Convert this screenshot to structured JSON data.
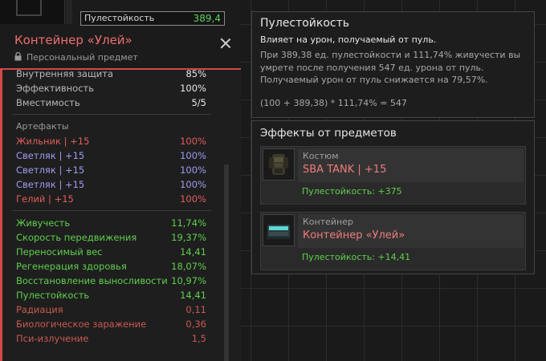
{
  "top_stat": {
    "label": "Пулестойкость",
    "value": "389,4"
  },
  "item": {
    "title": "Контейнер «Улей»",
    "subtitle": "Персональный предмет",
    "stats": [
      {
        "label": "Внутренняя защита",
        "value": "85%"
      },
      {
        "label": "Эффективность",
        "value": "100%"
      },
      {
        "label": "Вместимость",
        "value": "5/5"
      }
    ],
    "artifacts_header": "Артефакты",
    "artifacts": [
      {
        "label": "Жильник | +15",
        "value": "100%"
      },
      {
        "label": "Светляк | +15",
        "value": "100%"
      },
      {
        "label": "Светляк | +15",
        "value": "100%"
      },
      {
        "label": "Светляк | +15",
        "value": "100%"
      },
      {
        "label": "Гелий | +15",
        "value": "100%"
      }
    ],
    "effects_positive": [
      {
        "label": "Живучесть",
        "value": "11,74%"
      },
      {
        "label": "Скорость передвижения",
        "value": "19,37%"
      },
      {
        "label": "Переносимый вес",
        "value": "14,41"
      },
      {
        "label": "Регенерация здоровья",
        "value": "18,07%"
      },
      {
        "label": "Восстановление выносливости",
        "value": "10,97%"
      },
      {
        "label": "Пулестойкость",
        "value": "14,41"
      }
    ],
    "effects_negative": [
      {
        "label": "Радиация",
        "value": "0,11"
      },
      {
        "label": "Биологическое заражение",
        "value": "0,36"
      },
      {
        "label": "Пси-излучение",
        "value": "1,5"
      }
    ]
  },
  "tooltip": {
    "title": "Пулестойкость",
    "subtitle": "Влияет на урон, получаемый от пуль.",
    "description": "При 389,38 ед. пулестойкости и 111,74% живучести вы умрете после получения 547 ед. урона от пуль. Получаемый урон от пуль снижается на 79,57%.",
    "formula": "(100 + 389,38) * 111,74% = 547"
  },
  "effects_panel": {
    "title": "Эффекты от предметов",
    "cards": [
      {
        "category": "Костюм",
        "name": "SBA TANK | +15",
        "effect": "Пулестойкость: +375",
        "icon": "armor-suit-icon"
      },
      {
        "category": "Контейнер",
        "name": "Контейнер «Улей»",
        "effect": "Пулестойкость: +14,41",
        "icon": "container-icon"
      }
    ]
  },
  "colors": {
    "accent_red": "#d24848",
    "positive_green": "#5fcf4d",
    "artifact_blue": "#9f9cf2",
    "artifact_red": "#e25c5c"
  }
}
